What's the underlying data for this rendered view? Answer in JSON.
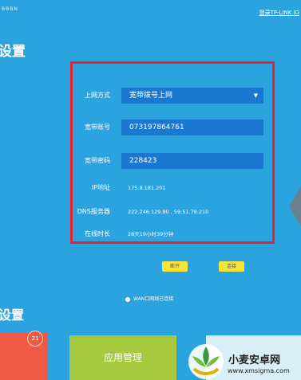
{
  "header": {
    "brand_fragment": "BBBN",
    "login_link": "登录TP-LINK ID"
  },
  "sections": {
    "top_title": "设置",
    "bottom_title": "设置"
  },
  "wan_panel": {
    "connection_type": {
      "label": "上网方式",
      "value": "宽带拨号上网"
    },
    "account": {
      "label": "宽带账号",
      "value": "073197864761"
    },
    "password": {
      "label": "宽带密码",
      "value": "228423"
    },
    "ip": {
      "label": "IP地址",
      "value": "175.8.181.201"
    },
    "dns": {
      "label": "DNS服务器",
      "value": "222.246.129.80 , 59.51.78.210"
    },
    "uptime": {
      "label": "在线时长",
      "value": "28天19小时39分钟"
    }
  },
  "buttons": {
    "disconnect": "断开",
    "connect": "连接"
  },
  "status": {
    "text": "WAN口网线已连接"
  },
  "tiles": {
    "badge_count": "21",
    "app_manage": "应用管理"
  },
  "watermark": {
    "title": "小麦安卓网",
    "url": "www.xmsigma.com"
  },
  "colors": {
    "background": "#2aa3df",
    "input_bg": "#1b78d0",
    "highlight_border": "#e8232b",
    "button": "#f5e43a",
    "tile_red": "#ef5a44",
    "tile_green": "#a7c93f"
  }
}
